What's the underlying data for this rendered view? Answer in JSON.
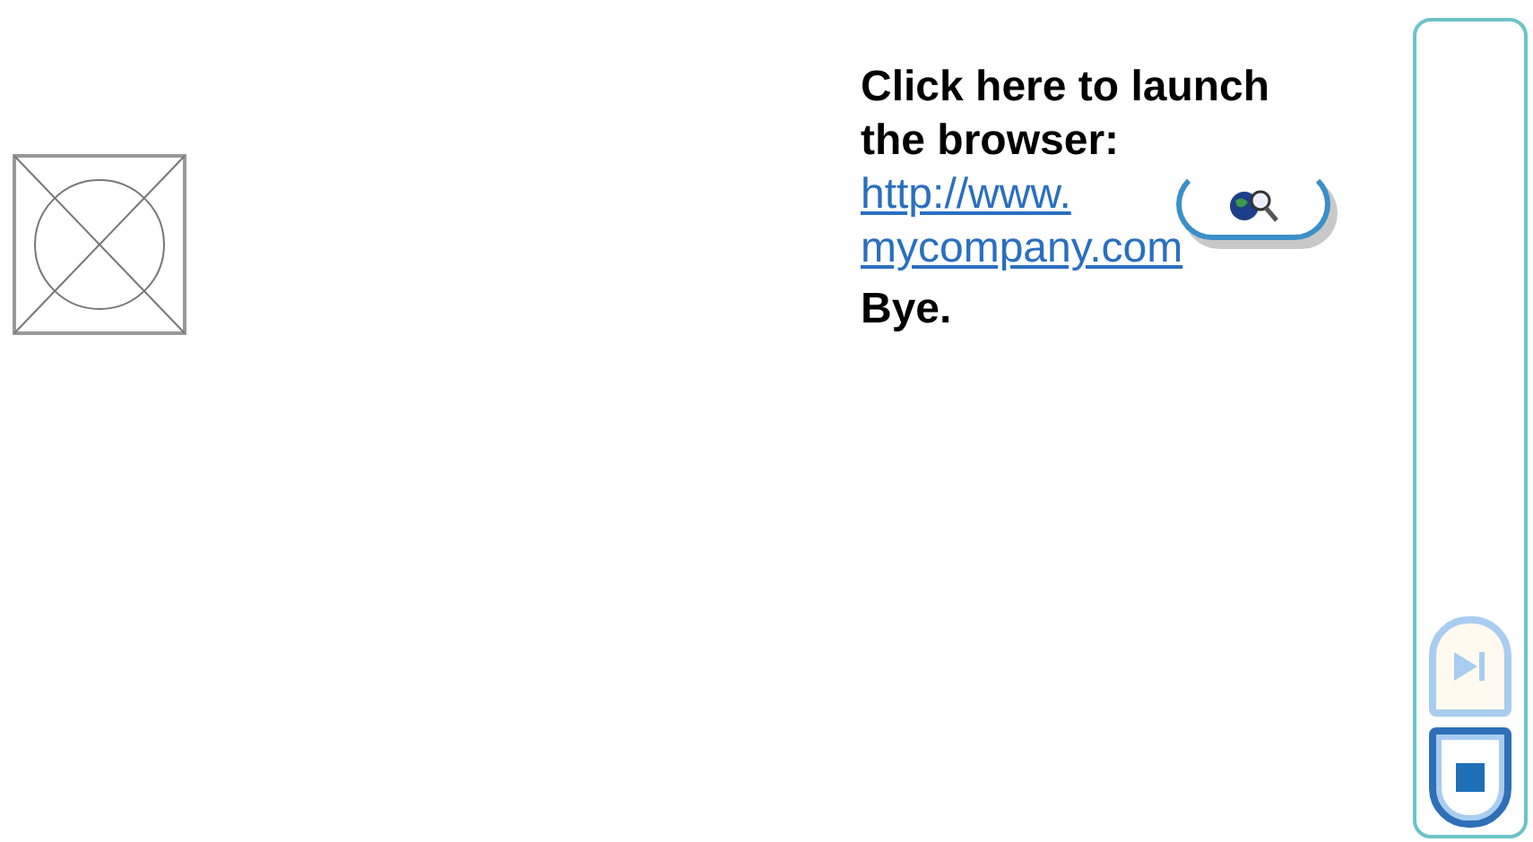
{
  "content": {
    "prompt": "Click here to launch the browser:",
    "link": "http://www.mycompany.com",
    "closing": "Bye."
  },
  "side_panel": {
    "buttons": [
      {
        "kind": "skip",
        "disabled": true
      },
      {
        "kind": "stop",
        "disabled": false
      }
    ]
  }
}
